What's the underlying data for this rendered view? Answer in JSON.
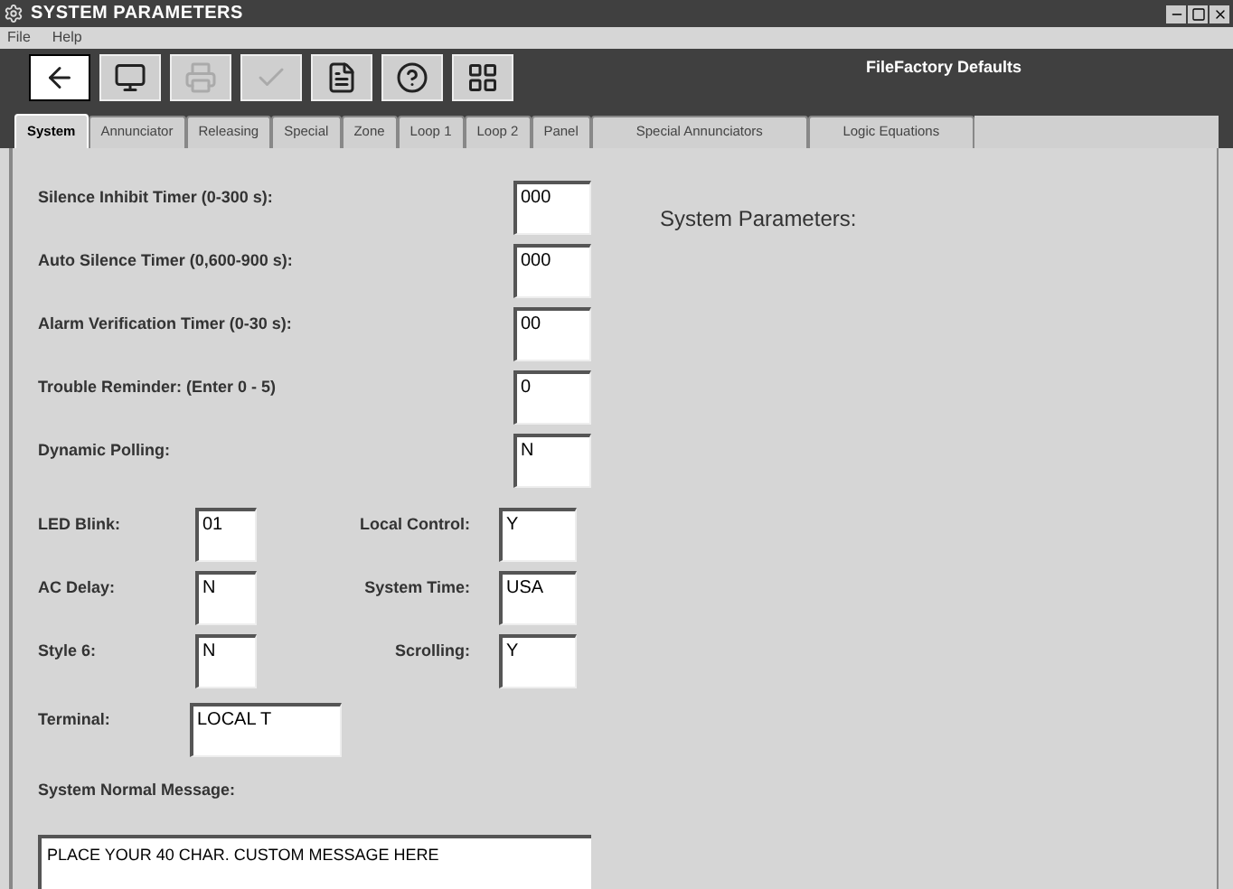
{
  "window": {
    "title": "SYSTEM PARAMETERS"
  },
  "menu": [
    "File",
    "Help"
  ],
  "toolbar": {
    "buttons": [
      {
        "kind": "back",
        "disabled": false
      },
      {
        "kind": "monitor",
        "disabled": false
      },
      {
        "kind": "printer",
        "disabled": true
      },
      {
        "kind": "check",
        "disabled": true
      },
      {
        "kind": "document",
        "disabled": false
      },
      {
        "kind": "help",
        "disabled": false
      },
      {
        "kind": "grid",
        "disabled": false
      }
    ],
    "caption": "FileFactory Defaults"
  },
  "tabs": [
    {
      "label": "System",
      "selected": true
    },
    {
      "label": "Annunciator",
      "selected": false
    },
    {
      "label": "Releasing",
      "selected": false
    },
    {
      "label": "Special",
      "selected": false
    },
    {
      "label": "Zone",
      "selected": false
    },
    {
      "label": "Loop 1",
      "selected": false
    },
    {
      "label": "Loop 2",
      "selected": false
    },
    {
      "label": "Panel",
      "selected": false
    },
    {
      "label": "Special Annunciators",
      "selected": false
    },
    {
      "label": "Logic Equations",
      "selected": false
    }
  ],
  "timers": [
    {
      "label": "Silence Inhibit Timer (0-300 s):",
      "value": "000"
    },
    {
      "label": "Auto Silence Timer (0,600-900 s):",
      "value": "000"
    },
    {
      "label": "Alarm Verification Timer (0-30 s):",
      "value": "00"
    },
    {
      "label": "Trouble Reminder:  (Enter 0 - 5)",
      "value": "0"
    },
    {
      "label": "Dynamic Polling:",
      "value": "N"
    }
  ],
  "pairs": [
    {
      "left": {
        "label": "LED Blink:",
        "value": "01"
      },
      "right": {
        "label": "Local Control:",
        "value": "Y"
      }
    },
    {
      "left": {
        "label": "AC Delay:",
        "value": "N"
      },
      "right": {
        "label": "System Time:",
        "value": "USA"
      }
    },
    {
      "left": {
        "label": "Style 6:",
        "value": "N"
      },
      "right": {
        "label": "Scrolling:",
        "value": "Y"
      }
    }
  ],
  "terminal": {
    "label": "Terminal:",
    "value": "LOCAL T"
  },
  "message": {
    "label": "System Normal Message:",
    "value": "PLACE YOUR 40 CHAR. CUSTOM MESSAGE HERE"
  },
  "panel_heading": "System Parameters:"
}
